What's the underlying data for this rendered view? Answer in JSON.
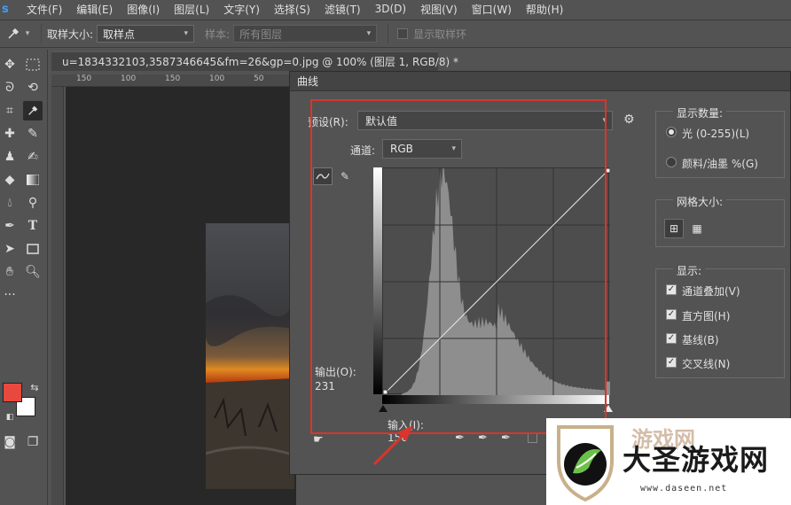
{
  "menubar": {
    "logo": "s",
    "items": [
      "文件(F)",
      "编辑(E)",
      "图像(I)",
      "图层(L)",
      "文字(Y)",
      "选择(S)",
      "滤镜(T)",
      "3D(D)",
      "视图(V)",
      "窗口(W)",
      "帮助(H)"
    ]
  },
  "options": {
    "sample_size_label": "取样大小:",
    "sample_size_value": "取样点",
    "sample_label": "样本:",
    "sample_value": "所有图层",
    "show_ring_label": "显示取样环"
  },
  "document": {
    "tab_title": "u=1834332103,3587346645&fm=26&gp=0.jpg @ 100% (图层 1, RGB/8) *",
    "ruler_ticks": [
      "150",
      "100",
      "150",
      "100",
      "50",
      "50"
    ]
  },
  "curves": {
    "title": "曲线",
    "preset_label": "预设(R):",
    "preset_value": "默认值",
    "channel_label": "通道:",
    "channel_value": "RGB",
    "output_label": "输出(O):",
    "output_value": "231",
    "input_label": "输入(I):",
    "input_value": "156",
    "display_amount": {
      "title": "显示数量:",
      "light": "光 (0-255)(L)",
      "pigment": "颜料/油墨 %(G)"
    },
    "grid_size": {
      "title": "网格大小:"
    },
    "show": {
      "title": "显示:",
      "items": [
        "通道叠加(V)",
        "直方图(H)",
        "基线(B)",
        "交叉线(N)"
      ]
    }
  },
  "watermark": {
    "brand": "大圣游戏网",
    "url": "www.daseen.net",
    "logo_partial": "游戏网"
  },
  "colors": {
    "foreground": "#e8493f",
    "background": "#ffffff",
    "highlight": "#d9352c"
  }
}
